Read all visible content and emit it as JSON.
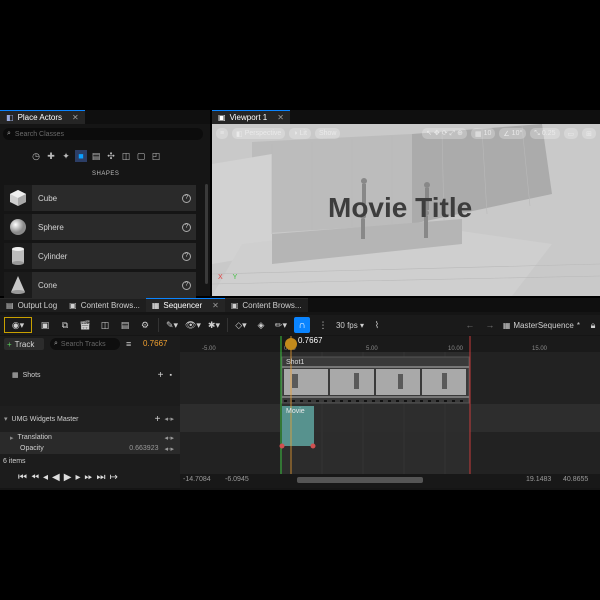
{
  "tabs_top": {
    "place_actors": "Place Actors",
    "viewport": "Viewport 1"
  },
  "place_actors": {
    "search_placeholder": "Search Classes",
    "category_label": "SHAPES",
    "items": [
      {
        "label": "Cube",
        "icon": "cube-icon"
      },
      {
        "label": "Sphere",
        "icon": "sphere-icon"
      },
      {
        "label": "Cylinder",
        "icon": "cylinder-icon"
      },
      {
        "label": "Cone",
        "icon": "cone-icon"
      }
    ]
  },
  "viewport": {
    "perspective": "Perspective",
    "lit": "Lit",
    "show": "Show",
    "grid_snap": "10",
    "rot_snap": "10°",
    "scale_snap": "0.25",
    "movie_title": "Movie Title",
    "axis_x": "X",
    "axis_y": "Y"
  },
  "dock_tabs": {
    "output_log": "Output Log",
    "content_browser_1": "Content Brows...",
    "sequencer": "Sequencer",
    "content_browser_2": "Content Brows..."
  },
  "sequencer": {
    "fps": "30 fps",
    "sequence_name": "MasterSequence",
    "track_button": "Track",
    "search_placeholder": "Search Tracks",
    "current_time": "0.7667",
    "playhead_time": "0.7667",
    "ruler": [
      "-5.00",
      "0.00",
      "5.00",
      "10.00",
      "15.00"
    ],
    "tracks": {
      "shots": "Shots",
      "umg": "UMG Widgets Master",
      "translation": "Translation",
      "opacity": "Opacity",
      "opacity_value": "0.663923"
    },
    "shot_clip_label": "Shot1",
    "movie_clip_label": "Movie",
    "item_count": "6 items",
    "view_start": "-14.7084",
    "view_in": "-6.0945",
    "view_out": "19.1483",
    "view_end": "40.8655",
    "accent": "#0a84ff",
    "playhead_color": "#f0a030",
    "clip_color": "#5fa5a0"
  }
}
